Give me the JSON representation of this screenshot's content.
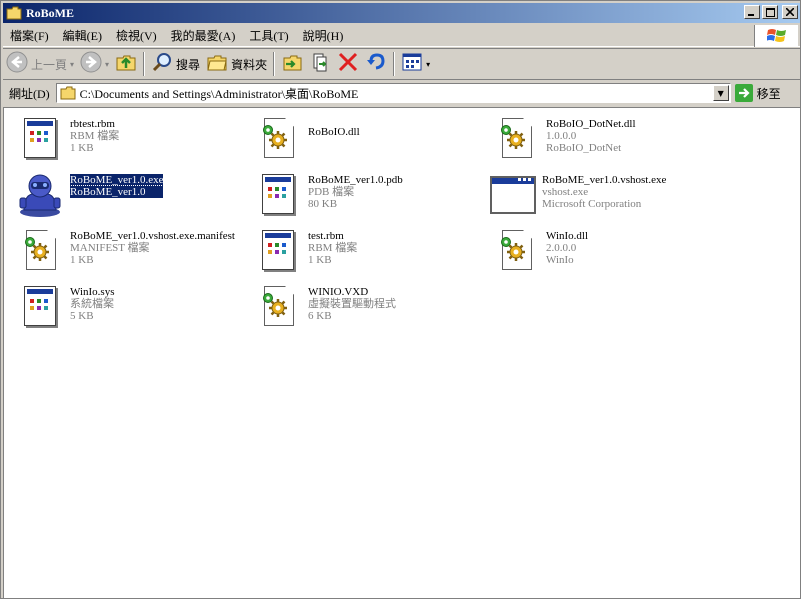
{
  "window": {
    "title": "RoBoME"
  },
  "menu": [
    "檔案(F)",
    "編輯(E)",
    "檢視(V)",
    "我的最愛(A)",
    "工具(T)",
    "說明(H)"
  ],
  "toolbar": {
    "back": "上一頁",
    "search": "搜尋",
    "folders": "資料夾"
  },
  "address": {
    "label": "網址(D)",
    "value": "C:\\Documents and Settings\\Administrator\\桌面\\RoBoME",
    "go": "移至"
  },
  "files": [
    {
      "name": "rbtest.rbm",
      "line2": "RBM 檔案",
      "line3": "1 KB",
      "icon": "doc-icon"
    },
    {
      "name": "RoBoIO.dll",
      "line2": "",
      "line3": "",
      "icon": "dll-icon"
    },
    {
      "name": "RoBoIO_DotNet.dll",
      "line2": "1.0.0.0",
      "line3": "RoBoIO_DotNet",
      "icon": "dll-icon"
    },
    {
      "name": "RoBoME_ver1.0.exe",
      "line2": "RoBoME_ver1.0",
      "line3": "",
      "icon": "robot-icon"
    },
    {
      "name": "RoBoME_ver1.0.pdb",
      "line2": "PDB 檔案",
      "line3": "80 KB",
      "icon": "doc-icon"
    },
    {
      "name": "RoBoME_ver1.0.vshost.exe",
      "line2": "vshost.exe",
      "line3": "Microsoft Corporation",
      "icon": "window-icon"
    },
    {
      "name": "RoBoME_ver1.0.vshost.exe.manifest",
      "line2": "MANIFEST 檔案",
      "line3": "1 KB",
      "icon": "dll-icon"
    },
    {
      "name": "test.rbm",
      "line2": "RBM 檔案",
      "line3": "1 KB",
      "icon": "doc-icon"
    },
    {
      "name": "WinIo.dll",
      "line2": "2.0.0.0",
      "line3": "WinIo",
      "icon": "dll-icon"
    },
    {
      "name": "WinIo.sys",
      "line2": "系統檔案",
      "line3": "5 KB",
      "icon": "doc-icon"
    },
    {
      "name": "WINIO.VXD",
      "line2": "虛擬裝置驅動程式",
      "line3": "6 KB",
      "icon": "dll-icon"
    }
  ],
  "selected_file": "RoBoME_ver1.0.exe"
}
